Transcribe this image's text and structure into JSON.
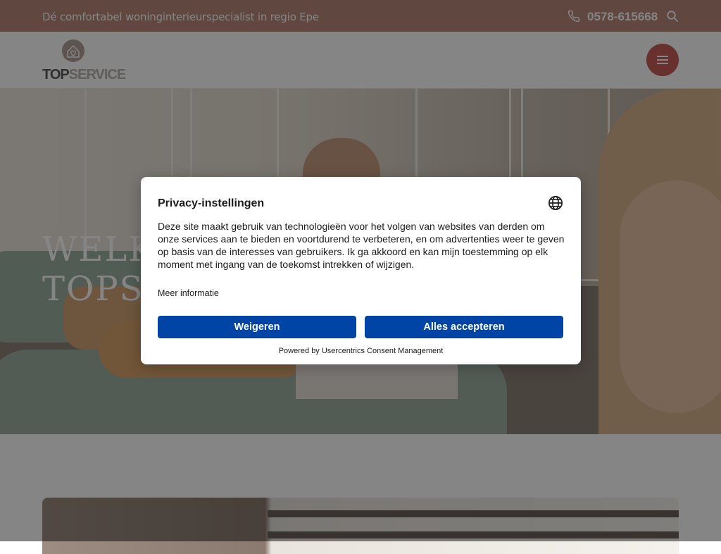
{
  "topbar": {
    "tagline": "Dé comfortabel woninginterieurspecialist in regio Epe",
    "phone": "0578-615668",
    "icons": [
      "phone-icon",
      "search-icon"
    ]
  },
  "header": {
    "logo": {
      "part1": "TOP",
      "part2": "SERVICE"
    },
    "menu_icon": "hamburger-icon",
    "menu_button_color": "#c85f57"
  },
  "hero": {
    "title_line1": "WELK",
    "title_line2": "TOPS"
  },
  "consent": {
    "title": "Privacy-instellingen",
    "body": "Deze site maakt gebruik van technologieën voor het volgen van websites van derden om onze services aan te bieden en voortdurend te verbeteren, en om advertenties weer te geven op basis van de interesses van gebruikers. Ik ga akkoord en kan mijn toestemming op elk moment met ingang van de toekomst intrekken of wijzigen.",
    "more_info": "Meer informatie",
    "deny_label": "Weigeren",
    "accept_label": "Alles accepteren",
    "powered_by": "Powered by Usercentrics Consent Management",
    "button_color": "#0045a5",
    "language_icon": "globe-icon"
  },
  "colors": {
    "topbar": "#b88a7c",
    "accent": "#c85f57"
  }
}
